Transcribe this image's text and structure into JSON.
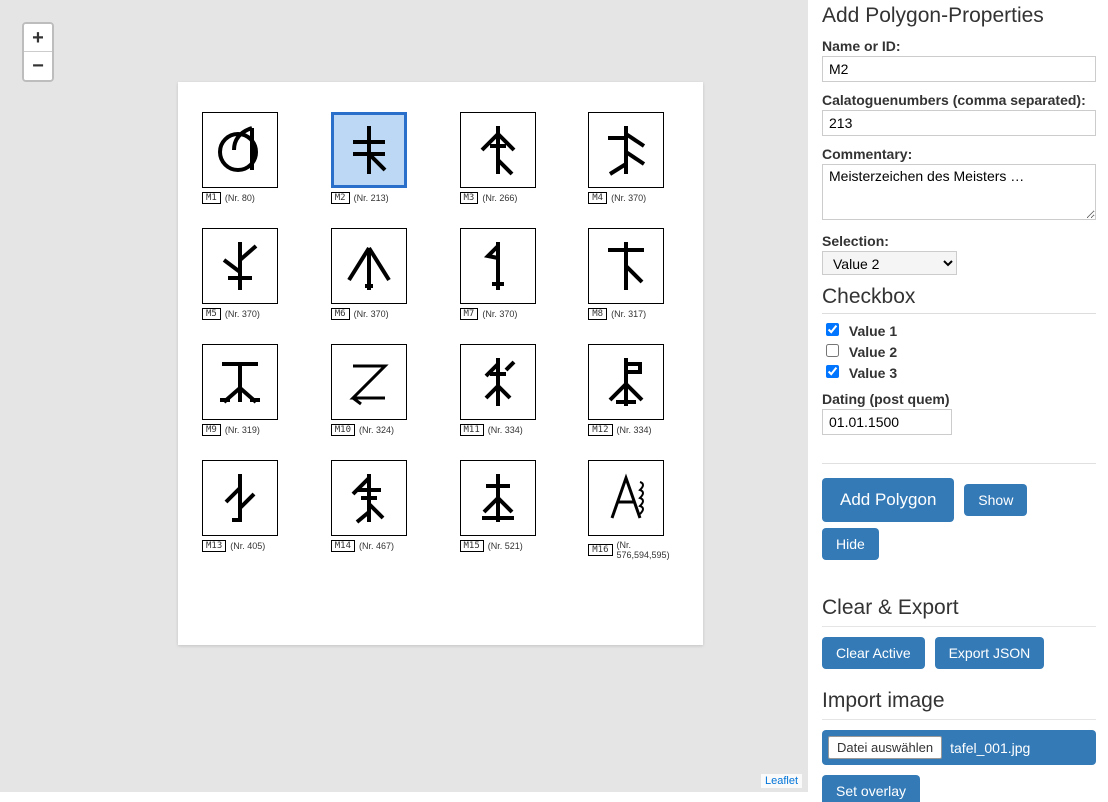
{
  "map": {
    "zoom_in": "+",
    "zoom_out": "−",
    "attribution": "Leaflet",
    "selected_index": 1,
    "cells": [
      {
        "id": "M1",
        "nr": "(Nr. 80)"
      },
      {
        "id": "M2",
        "nr": "(Nr. 213)"
      },
      {
        "id": "M3",
        "nr": "(Nr. 266)"
      },
      {
        "id": "M4",
        "nr": "(Nr. 370)"
      },
      {
        "id": "M5",
        "nr": "(Nr. 370)"
      },
      {
        "id": "M6",
        "nr": "(Nr. 370)"
      },
      {
        "id": "M7",
        "nr": "(Nr. 370)"
      },
      {
        "id": "M8",
        "nr": "(Nr. 317)"
      },
      {
        "id": "M9",
        "nr": "(Nr. 319)"
      },
      {
        "id": "M10",
        "nr": "(Nr. 324)"
      },
      {
        "id": "M11",
        "nr": "(Nr. 334)"
      },
      {
        "id": "M12",
        "nr": "(Nr. 334)"
      },
      {
        "id": "M13",
        "nr": "(Nr. 405)"
      },
      {
        "id": "M14",
        "nr": "(Nr. 467)"
      },
      {
        "id": "M15",
        "nr": "(Nr. 521)"
      },
      {
        "id": "M16",
        "nr": "(Nr. 576,594,595)"
      }
    ]
  },
  "form": {
    "heading": "Add Polygon-Properties",
    "name_label": "Name or ID:",
    "name_value": "M2",
    "catnum_label": "Calatoguenumbers (comma separated):",
    "catnum_value": "213",
    "commentary_label": "Commentary:",
    "commentary_value": "Meisterzeichen des Meisters …",
    "selection_label": "Selection:",
    "selection_value": "Value 2",
    "checkbox_heading": "Checkbox",
    "cbx": [
      {
        "label": "Value 1",
        "checked": true
      },
      {
        "label": "Value 2",
        "checked": false
      },
      {
        "label": "Value 3",
        "checked": true
      }
    ],
    "dating_label": "Dating (post quem)",
    "dating_value": "01.01.1500",
    "btn_add": "Add Polygon",
    "btn_show": "Show",
    "btn_hide": "Hide",
    "clear_export_heading": "Clear & Export",
    "btn_clear": "Clear Active",
    "btn_export": "Export JSON",
    "import_heading": "Import image",
    "file_button": "Datei auswählen",
    "file_name": "tafel_001.jpg",
    "btn_overlay": "Set overlay"
  }
}
